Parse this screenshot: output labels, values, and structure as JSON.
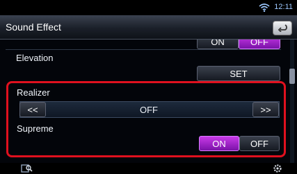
{
  "status": {
    "time": "12:11"
  },
  "header": {
    "title": "Sound Effect"
  },
  "top_row": {
    "on_label": "ON",
    "off_label": "OFF",
    "selected": "OFF"
  },
  "elevation": {
    "label": "Elevation",
    "set_label": "SET"
  },
  "realizer": {
    "label": "Realizer",
    "prev_label": "<<",
    "value": "OFF",
    "next_label": ">>"
  },
  "supreme": {
    "label": "Supreme",
    "on_label": "ON",
    "off_label": "OFF",
    "selected": "ON"
  },
  "colors": {
    "highlight": "#e0101e",
    "active": "#b02cd8",
    "accent": "#9ec9ff"
  },
  "icons": {
    "wifi": "wifi-icon",
    "back": "back-arrow-icon",
    "bottom_left": "search-icon",
    "bottom_right": "settings-icon"
  }
}
